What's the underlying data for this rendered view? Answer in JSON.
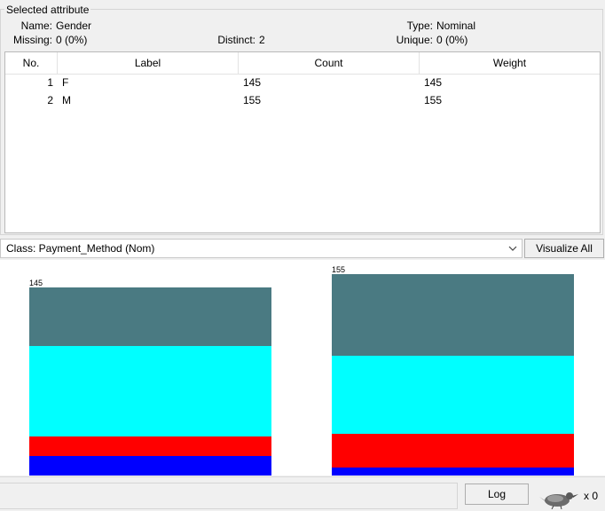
{
  "attribute_panel": {
    "title": "Selected attribute",
    "name_label": "Name:",
    "name_value": "Gender",
    "type_label": "Type:",
    "type_value": "Nominal",
    "missing_label": "Missing:",
    "missing_value": "0 (0%)",
    "distinct_label": "Distinct:",
    "distinct_value": "2",
    "unique_label": "Unique:",
    "unique_value": "0 (0%)"
  },
  "table": {
    "columns": [
      "No.",
      "Label",
      "Count",
      "Weight"
    ],
    "rows": [
      {
        "no": "1",
        "label": "F",
        "count": "145",
        "weight": "145"
      },
      {
        "no": "2",
        "label": "M",
        "count": "155",
        "weight": "155"
      }
    ]
  },
  "class_selector": {
    "value": "Class: Payment_Method (Nom)"
  },
  "visualize_all_label": "Visualize All",
  "chart_data": {
    "type": "bar",
    "stacked": true,
    "categories": [
      "F",
      "M"
    ],
    "totals": [
      145,
      155
    ],
    "top_labels": [
      "145",
      "155"
    ],
    "series": [
      {
        "color": "#4a7a82",
        "values": [
          45,
          63
        ]
      },
      {
        "color": "#00ffff",
        "values": [
          70,
          60
        ]
      },
      {
        "color": "#ff0000",
        "values": [
          15,
          26
        ]
      },
      {
        "color": "#0000ff",
        "values": [
          15,
          6
        ]
      }
    ],
    "ylim": [
      0,
      160
    ]
  },
  "status": {
    "log_label": "Log",
    "task_count": "x 0",
    "icon": "weka-bird-icon"
  }
}
